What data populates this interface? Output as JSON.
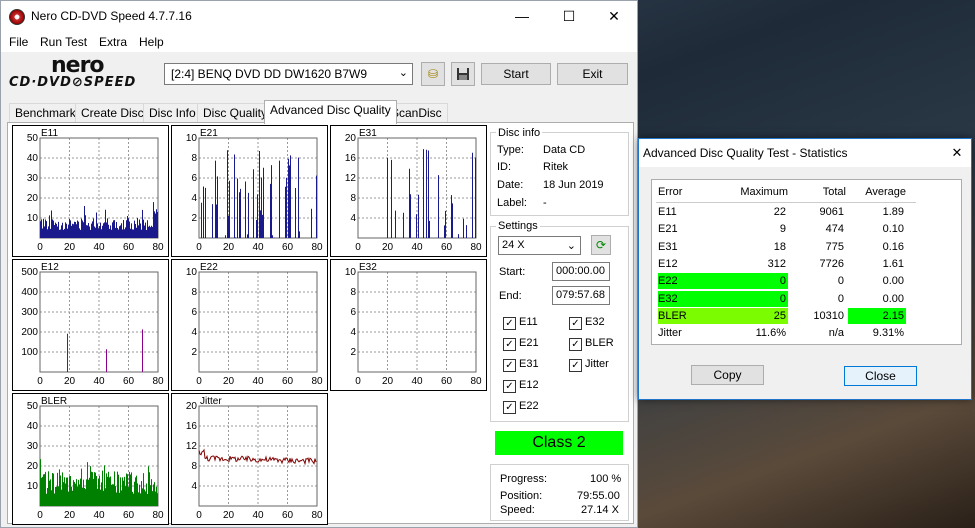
{
  "window": {
    "title": "Nero CD-DVD Speed 4.7.7.16",
    "minimize": "—",
    "maximize": "☐",
    "close": "✕"
  },
  "menu": [
    "File",
    "Run Test",
    "Extra",
    "Help"
  ],
  "logo": {
    "line1": "nero",
    "line2": "CD·DVD⊘SPEED"
  },
  "drive": {
    "selected": "[2:4]   BENQ DVD DD DW1620 B7W9",
    "chevron": "⌄"
  },
  "toolbar": {
    "start_label": "Start",
    "exit_label": "Exit",
    "eject_icon": "⛁",
    "save_icon": "💾"
  },
  "tabs": [
    "Benchmark",
    "Create Disc",
    "Disc Info",
    "Disc Quality",
    "Advanced Disc Quality",
    "ScanDisc"
  ],
  "active_tab": 4,
  "disc_info": {
    "group": "Disc info",
    "type_label": "Type:",
    "type": "Data CD",
    "id_label": "ID:",
    "id": "Ritek",
    "date_label": "Date:",
    "date": "18 Jun 2019",
    "label_label": "Label:",
    "label": "-"
  },
  "settings": {
    "group": "Settings",
    "speed": "24 X",
    "start_label": "Start:",
    "start": "000:00.00",
    "end_label": "End:",
    "end": "079:57.68"
  },
  "checks": [
    {
      "label": "E11",
      "checked": true
    },
    {
      "label": "E32",
      "checked": true
    },
    {
      "label": "E21",
      "checked": true
    },
    {
      "label": "BLER",
      "checked": true
    },
    {
      "label": "E31",
      "checked": true
    },
    {
      "label": "Jitter",
      "checked": true
    },
    {
      "label": "E12",
      "checked": true
    },
    {
      "label": "E22",
      "checked": true
    }
  ],
  "class_label": "Class 2",
  "progress": {
    "progress_label": "Progress:",
    "progress": "100 %",
    "position_label": "Position:",
    "position": "79:55.00",
    "speed_label": "Speed:",
    "speed": "27.14 X"
  },
  "chart_data": [
    {
      "name": "E11",
      "type": "bar",
      "ylim": [
        0,
        50
      ],
      "yticks": [
        10,
        20,
        30,
        40,
        50
      ],
      "xticks": [
        0,
        20,
        40,
        60,
        80
      ],
      "color": "#1a1a8c"
    },
    {
      "name": "E21",
      "type": "bar",
      "ylim": [
        0,
        10
      ],
      "yticks": [
        2,
        4,
        6,
        8,
        10
      ],
      "xticks": [
        0,
        20,
        40,
        60,
        80
      ],
      "color": "#1a1a8c"
    },
    {
      "name": "E31",
      "type": "bar",
      "ylim": [
        0,
        20
      ],
      "yticks": [
        4,
        8,
        12,
        16,
        20
      ],
      "xticks": [
        0,
        20,
        40,
        60,
        80
      ],
      "color": "#1a1a8c"
    },
    {
      "name": "E12",
      "type": "bar",
      "ylim": [
        0,
        500
      ],
      "yticks": [
        100,
        200,
        300,
        400,
        500
      ],
      "xticks": [
        0,
        20,
        40,
        60,
        80
      ],
      "color": "#8b008b"
    },
    {
      "name": "E22",
      "type": "bar",
      "ylim": [
        0,
        10
      ],
      "yticks": [
        2,
        4,
        6,
        8,
        10
      ],
      "xticks": [
        0,
        20,
        40,
        60,
        80
      ],
      "color": "#1a1a8c"
    },
    {
      "name": "E32",
      "type": "bar",
      "ylim": [
        0,
        10
      ],
      "yticks": [
        2,
        4,
        6,
        8,
        10
      ],
      "xticks": [
        0,
        20,
        40,
        60,
        80
      ],
      "color": "#1a1a8c"
    },
    {
      "name": "BLER",
      "type": "bar",
      "ylim": [
        0,
        50
      ],
      "yticks": [
        10,
        20,
        30,
        40,
        50
      ],
      "xticks": [
        0,
        20,
        40,
        60,
        80
      ],
      "color": "#008000"
    },
    {
      "name": "Jitter",
      "type": "line",
      "ylim": [
        0,
        20
      ],
      "yticks": [
        4,
        8,
        12,
        16,
        20
      ],
      "xticks": [
        0,
        20,
        40,
        60,
        80
      ],
      "color": "#800000"
    }
  ],
  "stats": {
    "title": "Advanced Disc Quality Test - Statistics",
    "close_icon": "✕",
    "headers": [
      "Error",
      "Maximum",
      "Total",
      "Average"
    ],
    "rows": [
      {
        "error": "E11",
        "max": "22",
        "total": "9061",
        "avg": "1.89"
      },
      {
        "error": "E21",
        "max": "9",
        "total": "474",
        "avg": "0.10"
      },
      {
        "error": "E31",
        "max": "18",
        "total": "775",
        "avg": "0.16"
      },
      {
        "error": "E12",
        "max": "312",
        "total": "7726",
        "avg": "1.61"
      },
      {
        "error": "E22",
        "max": "0",
        "total": "0",
        "avg": "0.00"
      },
      {
        "error": "E32",
        "max": "0",
        "total": "0",
        "avg": "0.00"
      },
      {
        "error": "BLER",
        "max": "25",
        "total": "10310",
        "avg": "2.15"
      },
      {
        "error": "Jitter",
        "max": "11.6%",
        "total": "n/a",
        "avg": "9.31%"
      }
    ],
    "copy_label": "Copy",
    "close_label": "Close"
  }
}
